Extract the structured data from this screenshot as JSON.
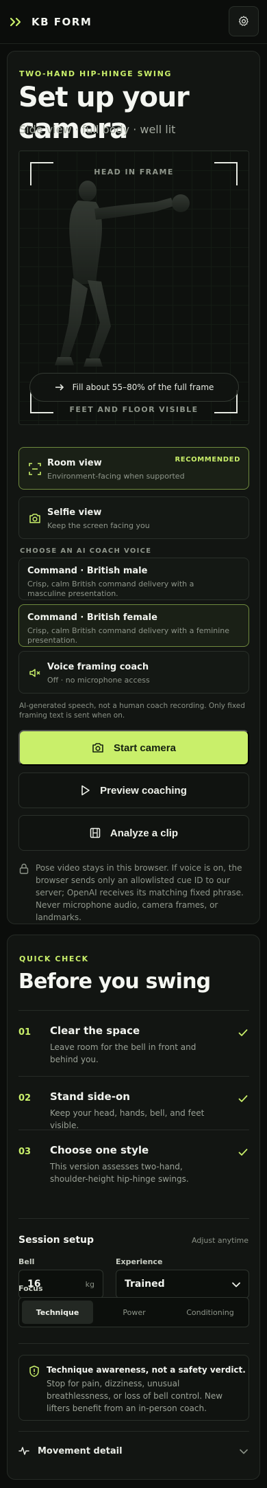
{
  "header": {
    "brand": "KB FORM",
    "logo_icon": "double-chevron-right-icon",
    "settings_icon": "gear-icon"
  },
  "colors": {
    "accent": "#c9ef6a",
    "background": "#0b0d0b",
    "card": "#121512"
  },
  "setup": {
    "eyebrow": "TWO-HAND HIP-HINGE SWING",
    "title": "Set up your camera",
    "subtitle": "Side view · full body · well lit",
    "frame": {
      "top_label": "HEAD IN FRAME",
      "bottom_label": "FEET AND FLOOR VISIBLE",
      "hint": "Fill about 55–80% of the full frame"
    },
    "views": [
      {
        "title": "Room view",
        "sub": "Environment-facing when supported",
        "badge": "RECOMMENDED",
        "icon": "focus-frame-icon",
        "selected": true
      },
      {
        "title": "Selfie view",
        "sub": "Keep the screen facing you",
        "icon": "camera-icon",
        "selected": false
      }
    ],
    "voice_section_label": "CHOOSE AN AI COACH VOICE",
    "voices": [
      {
        "title": "Command · British male",
        "sub": "Crisp, calm British command delivery with a masculine presentation.",
        "selected": false
      },
      {
        "title": "Command · British female",
        "sub": "Crisp, calm British command delivery with a feminine presentation.",
        "selected": true
      }
    ],
    "voice_coach": {
      "title": "Voice framing coach",
      "sub": "Off · no microphone access",
      "icon": "speaker-muted-icon"
    },
    "ai_note": "AI-generated speech, not a human coach recording. Only fixed framing text is sent when on.",
    "buttons": {
      "start": "Start camera",
      "preview": "Preview coaching",
      "analyze": "Analyze a clip"
    },
    "privacy": "Pose video stays in this browser. If voice is on, the browser sends only an allowlisted cue ID to our server; OpenAI receives its matching fixed phrase. Never microphone audio, camera frames, or landmarks."
  },
  "check": {
    "eyebrow": "QUICK CHECK",
    "title": "Before you swing",
    "steps": [
      {
        "num": "01",
        "title": "Clear the space",
        "sub": "Leave room for the bell in front and behind you.",
        "done": true
      },
      {
        "num": "02",
        "title": "Stand side-on",
        "sub": "Keep your head, hands, bell, and feet visible.",
        "done": true
      },
      {
        "num": "03",
        "title": "Choose one style",
        "sub": "This version assesses two-hand, shoulder-height hip-hinge swings.",
        "done": true
      }
    ],
    "session": {
      "title": "Session setup",
      "aside": "Adjust anytime",
      "bell_label": "Bell",
      "bell_value": "16",
      "bell_unit": "kg",
      "experience_label": "Experience",
      "experience_value": "Trained",
      "focus_label": "Focus",
      "focus_options": [
        "Technique",
        "Power",
        "Conditioning"
      ],
      "focus_selected": "Technique"
    },
    "warning": {
      "title": "Technique awareness, not a safety verdict.",
      "body": "Stop for pain, dizziness, unusual breathlessness, or loss of bell control. New lifters benefit from an in-person coach."
    },
    "movement_detail": "Movement detail"
  }
}
